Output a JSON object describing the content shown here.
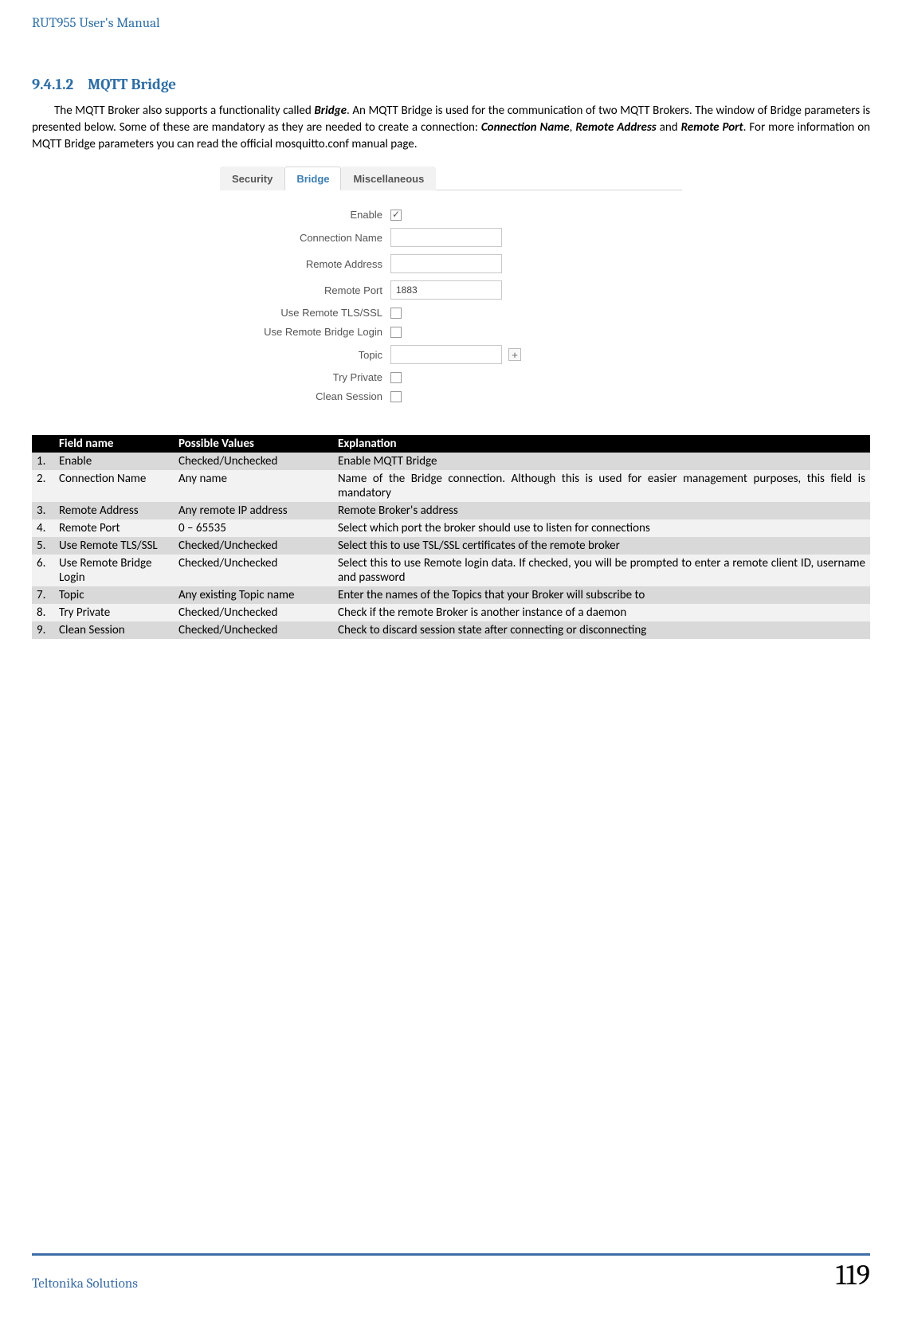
{
  "header": {
    "title": "RUT955 User's Manual"
  },
  "section": {
    "number": "9.4.1.2",
    "title": "MQTT Bridge"
  },
  "paragraph": "The MQTT Broker also supports a functionality called Bridge. An MQTT Bridge is used for the communication of two MQTT Brokers. The window of Bridge parameters is presented below. Some of these are mandatory as they are needed to create a connection: Connection Name, Remote Address and Remote Port. For more information on MQTT Bridge parameters you can read the official mosquitto.conf manual page.",
  "form": {
    "tabs": [
      "Security",
      "Bridge",
      "Miscellaneous"
    ],
    "active_tab": "Bridge",
    "rows": {
      "enable": {
        "label": "Enable",
        "checked": true
      },
      "connection_name": {
        "label": "Connection Name",
        "value": ""
      },
      "remote_address": {
        "label": "Remote Address",
        "value": ""
      },
      "remote_port": {
        "label": "Remote Port",
        "value": "1883"
      },
      "use_remote_tls": {
        "label": "Use Remote TLS/SSL",
        "checked": false
      },
      "use_remote_login": {
        "label": "Use Remote Bridge Login",
        "checked": false
      },
      "topic": {
        "label": "Topic",
        "value": ""
      },
      "try_private": {
        "label": "Try Private",
        "checked": false
      },
      "clean_session": {
        "label": "Clean Session",
        "checked": false
      }
    }
  },
  "table": {
    "headers": {
      "field": "Field name",
      "values": "Possible Values",
      "explanation": "Explanation"
    },
    "rows": [
      {
        "n": "1.",
        "field": "Enable",
        "values": "Checked/Unchecked",
        "explanation": "Enable MQTT Bridge"
      },
      {
        "n": "2.",
        "field": "Connection Name",
        "values": "Any name",
        "explanation": "Name of the Bridge connection. Although this is used for easier management purposes, this field is mandatory"
      },
      {
        "n": "3.",
        "field": "Remote Address",
        "values": "Any remote IP address",
        "explanation": "Remote Broker's address"
      },
      {
        "n": "4.",
        "field": "Remote Port",
        "values": "0 – 65535",
        "explanation": "Select which port the broker should use to listen for connections"
      },
      {
        "n": "5.",
        "field": "Use Remote TLS/SSL",
        "values": "Checked/Unchecked",
        "explanation": "Select this to use TSL/SSL certificates of the remote broker"
      },
      {
        "n": "6.",
        "field": "Use Remote Bridge Login",
        "values": "Checked/Unchecked",
        "explanation": "Select this to use Remote login data. If checked, you will be prompted to enter a remote client ID, username and password"
      },
      {
        "n": "7.",
        "field": "Topic",
        "values": "Any existing Topic name",
        "explanation": "Enter the names of the Topics that your Broker will subscribe to"
      },
      {
        "n": "8.",
        "field": "Try Private",
        "values": "Checked/Unchecked",
        "explanation": "Check if the remote Broker is another instance of a daemon"
      },
      {
        "n": "9.",
        "field": "Clean Session",
        "values": "Checked/Unchecked",
        "explanation": "Check to discard session state after connecting or disconnecting"
      }
    ]
  },
  "footer": {
    "left": "Teltonika Solutions",
    "page": "119"
  }
}
